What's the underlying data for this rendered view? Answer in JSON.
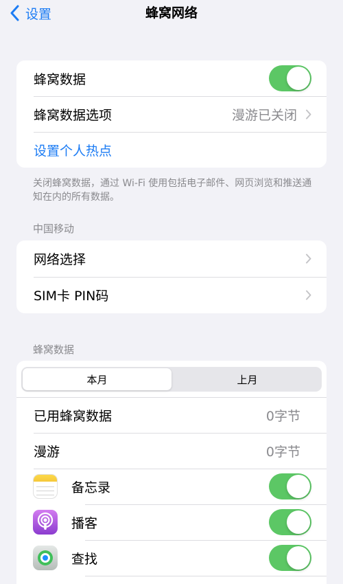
{
  "nav": {
    "back_label": "设置",
    "title": "蜂窝网络"
  },
  "main_group": {
    "cellular_data": {
      "label": "蜂窝数据",
      "toggle_on": true
    },
    "cellular_options": {
      "label": "蜂窝数据选项",
      "value": "漫游已关闭"
    },
    "hotspot": {
      "label": "设置个人热点"
    }
  },
  "note": "关闭蜂窝数据，通过 Wi-Fi 使用包括电子邮件、网页浏览和推送通知在内的所有数据。",
  "carrier": {
    "header": "中国移动",
    "network_selection": "网络选择",
    "sim_pin": "SIM卡 PIN码"
  },
  "usage": {
    "header": "蜂窝数据",
    "segments": [
      "本月",
      "上月"
    ],
    "selected_segment": "本月",
    "used": {
      "label": "已用蜂窝数据",
      "value": "0字节"
    },
    "roaming": {
      "label": "漫游",
      "value": "0字节"
    },
    "apps": [
      {
        "name": "备忘录",
        "icon": "notes-icon",
        "toggle_on": true
      },
      {
        "name": "播客",
        "icon": "podcasts-icon",
        "toggle_on": true
      },
      {
        "name": "查找",
        "icon": "find-my-icon",
        "toggle_on": true
      }
    ]
  },
  "colors": {
    "accent": "#1c7cf4",
    "toggle_on": "#5cc765",
    "background": "#f2f2f7"
  }
}
